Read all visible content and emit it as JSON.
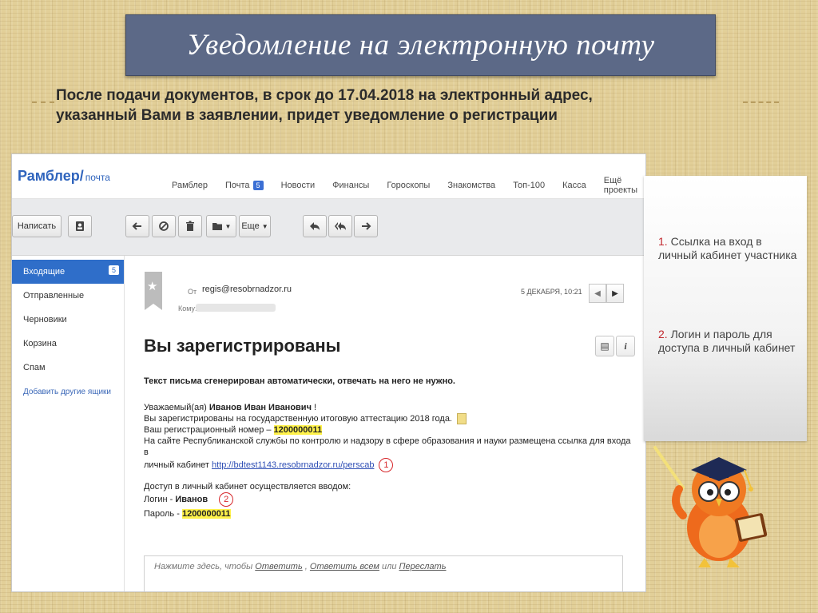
{
  "slide": {
    "title": "Уведомление на электронную почту",
    "subtitle_line1": "После подачи документов, в срок до 17.04.2018 на электронный адрес,",
    "subtitle_line2": "указанный Вами в заявлении, придет уведомление о регистрации"
  },
  "mail": {
    "logo": "Рамблер/",
    "logo_sub": "почта",
    "nav": [
      {
        "label": "Рамблер"
      },
      {
        "label": "Почта",
        "badge": "5"
      },
      {
        "label": "Новости"
      },
      {
        "label": "Финансы"
      },
      {
        "label": "Гороскопы"
      },
      {
        "label": "Знакомства"
      },
      {
        "label": "Топ-100"
      },
      {
        "label": "Касса"
      },
      {
        "label": "Ещё проекты"
      }
    ],
    "toolbar": {
      "compose": "Написать",
      "more": "Еще"
    },
    "sidebar": {
      "inbox": "Входящие",
      "inbox_count": "5",
      "sent": "Отправленные",
      "drafts": "Черновики",
      "trash": "Корзина",
      "spam": "Спам",
      "add_boxes": "Добавить другие ящики"
    },
    "message": {
      "from_label": "От",
      "from": "regis@resobrnadzor.ru",
      "to_label": "Кому:",
      "date": "5 ДЕКАБРЯ, 10:21",
      "subject": "Вы зарегистрированы",
      "auto_note": "Текст письма сгенерирован автоматически, отвечать на него не нужно.",
      "greeting_prefix": "Уважаемый(ая) ",
      "greeting_name": "Иванов Иван Иванович",
      "greeting_suffix": " !",
      "registered_text": "Вы зарегистрированы на государственную итоговую аттестацию 2018 года.",
      "reg_num_label": "Ваш регистрационный номер – ",
      "reg_num": "1200000011",
      "site_line1": "На сайте Республиканской службы по контролю и надзору в сфере образования и науки размещена ссылка для входа в",
      "site_line2_prefix": "личный кабинет ",
      "site_link": "http://bdtest1143.resobrnadzor.ru/perscab",
      "marker1": "1",
      "access_line": "Доступ в личный кабинет осуществляется вводом:",
      "login_label": "Логин - ",
      "login": "Иванов",
      "marker2": "2",
      "password_label": "Пароль - ",
      "password": "1200000011",
      "reply_prefix": "Нажмите здесь, чтобы ",
      "reply": "Ответить",
      "reply_all": "Ответить всем",
      "forward": "Переслать",
      "or": " или ",
      "comma": " , "
    }
  },
  "callout": {
    "item1_num": "1.",
    "item1_text": " Ссылка на вход в личный кабинет участника",
    "item2_num": "2.",
    "item2_text": " Логин и пароль для доступа в личный кабинет"
  },
  "colors": {
    "title_bg": "#5c6987",
    "accent_blue": "#2f6ec9",
    "highlight": "#fff24a",
    "marker_red": "#d6262a"
  }
}
